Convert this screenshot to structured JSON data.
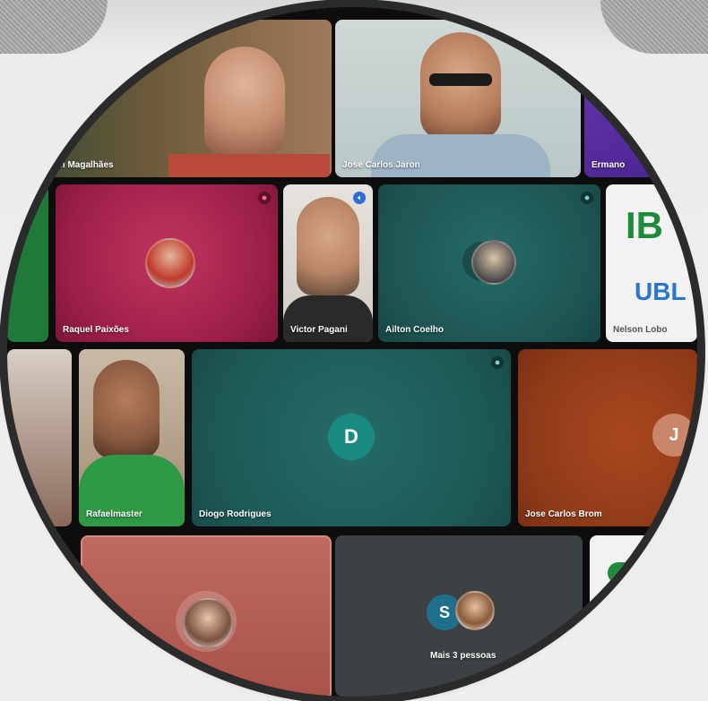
{
  "participants": [
    {
      "name": "Cleyton Magalhães"
    },
    {
      "name": "Jose Carlos Jaron"
    },
    {
      "name": "Ermano"
    },
    {
      "name": "Raquel Paixões"
    },
    {
      "name": "Victor Pagani"
    },
    {
      "name": "Ailton Coelho"
    },
    {
      "name": "Nelson Lobo"
    },
    {
      "name": "Rafaelmaster"
    },
    {
      "name": "Diogo Rodrigues",
      "initial": "D"
    },
    {
      "name": "Jose Carlos Brom",
      "initial": "J"
    },
    {
      "name": "Mais 3 pessoas",
      "initial": "S"
    }
  ],
  "logo": {
    "line1": "IB",
    "line2": "UBL"
  },
  "colors": {
    "teal": "#1f5b58",
    "crimson": "#a8234e",
    "rust": "#9a3f1e",
    "salmon": "#b75a50",
    "slate": "#3c4143",
    "purple": "#5a2ea0"
  },
  "icons": {
    "mic-off": "mic-off-icon",
    "pin": "pin-icon"
  }
}
